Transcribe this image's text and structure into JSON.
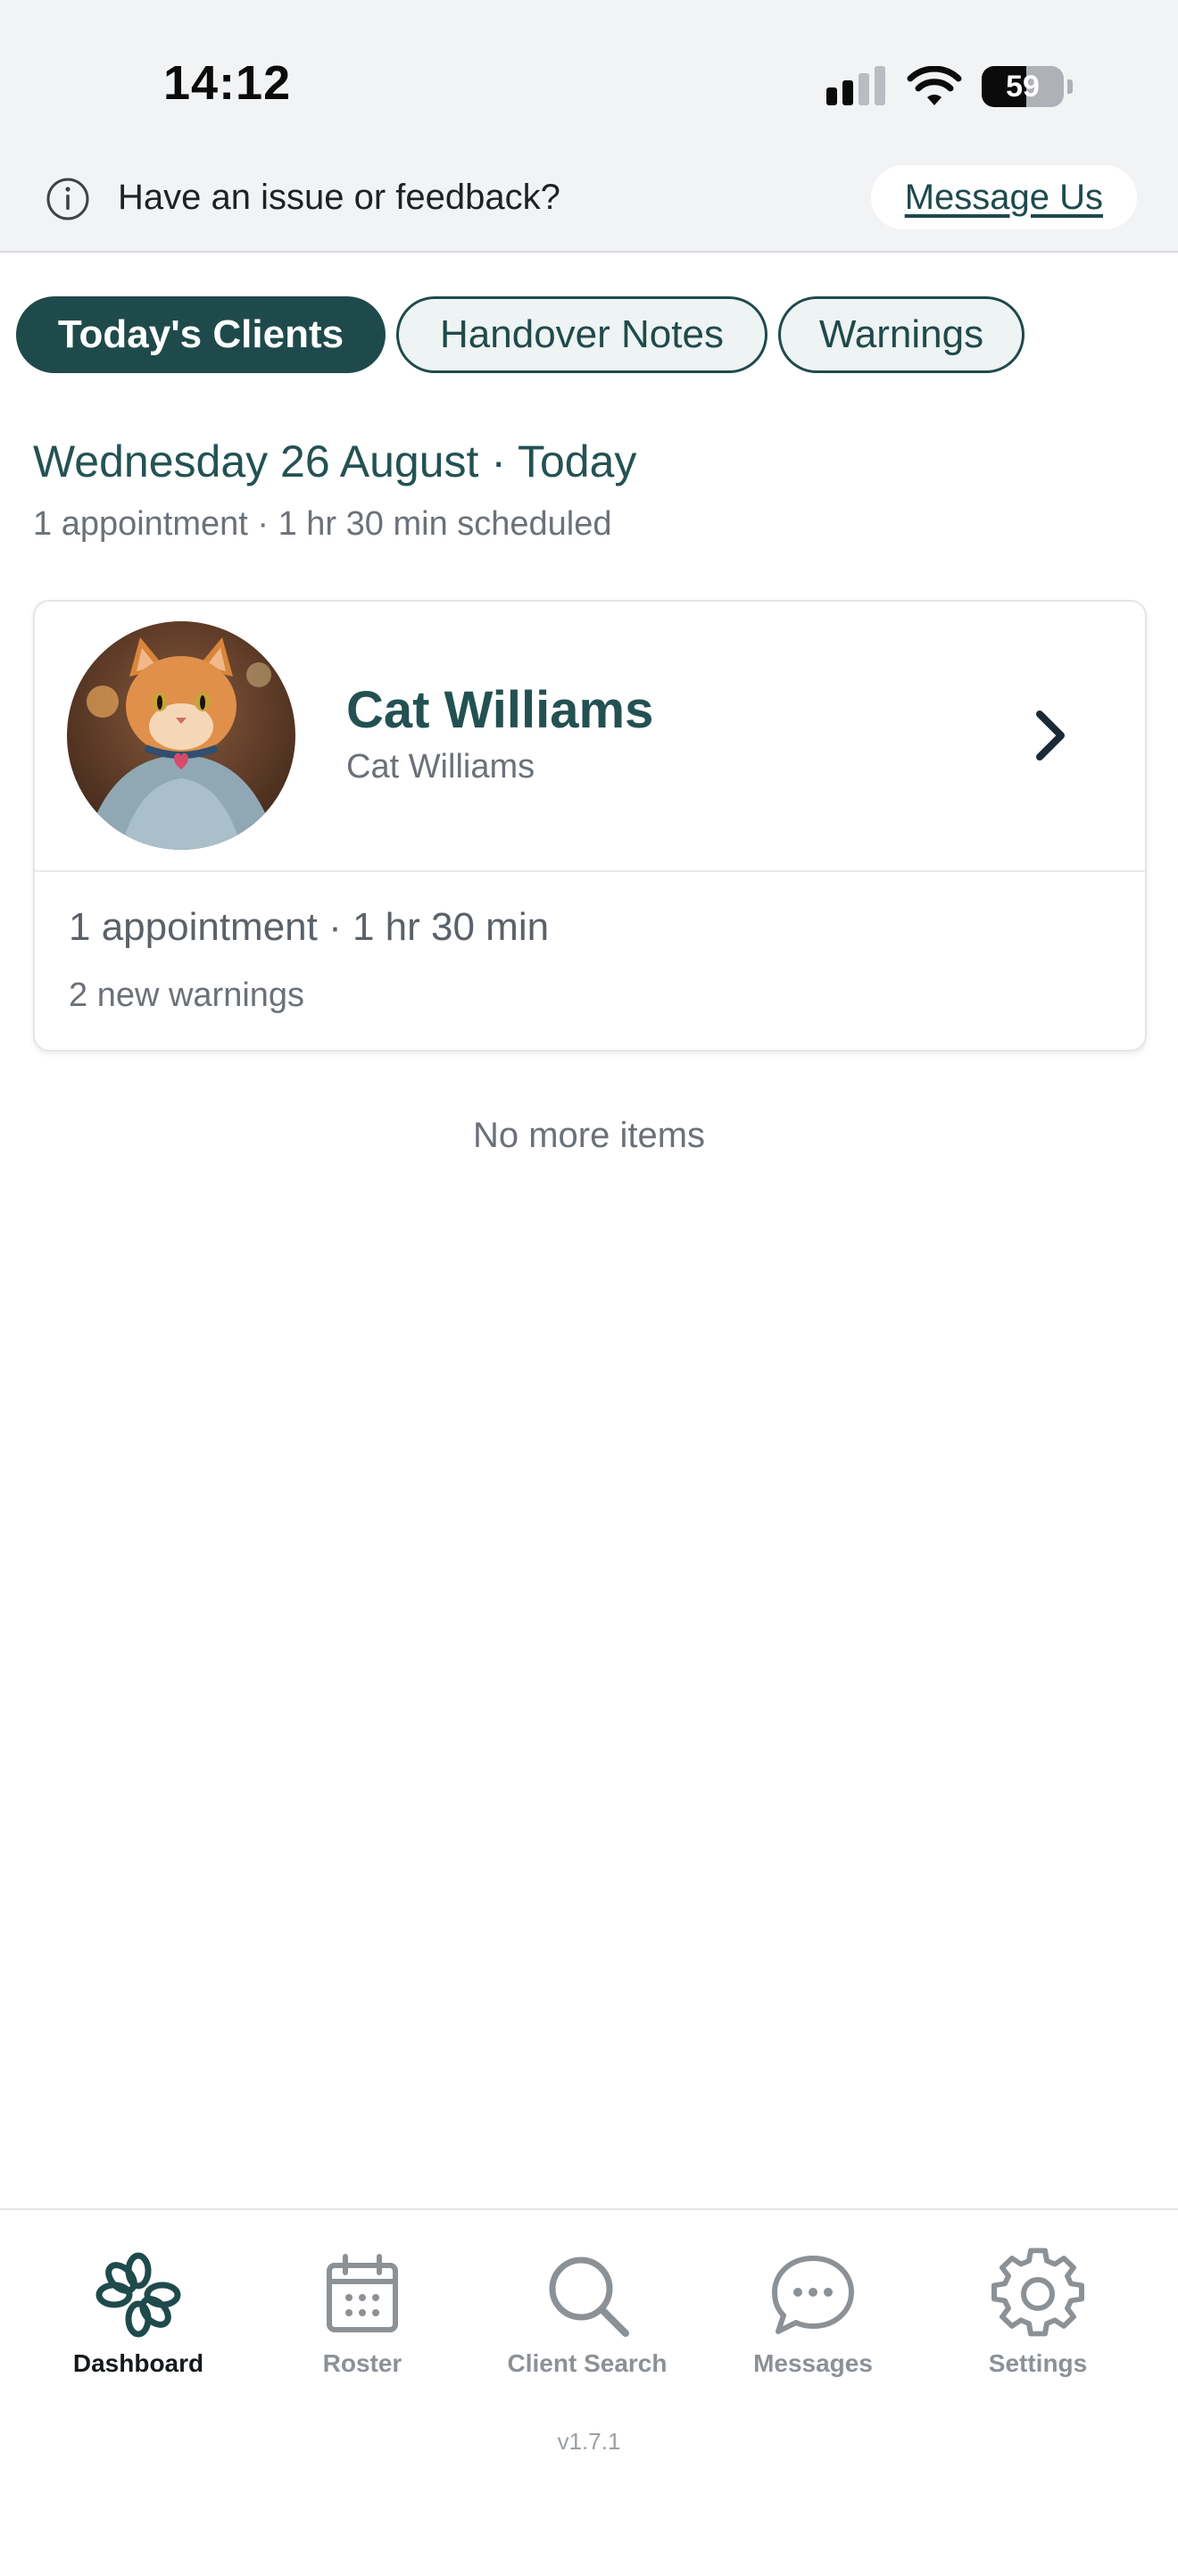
{
  "status_bar": {
    "time": "14:12",
    "battery_level": "59",
    "icons": [
      "cellular-signal-icon",
      "wifi-icon",
      "battery-icon"
    ]
  },
  "feedback": {
    "text": "Have an issue or feedback?",
    "link_label": "Message Us",
    "icon": "info-icon"
  },
  "tabs": [
    {
      "label": "Today's Clients",
      "active": true
    },
    {
      "label": "Handover Notes",
      "active": false
    },
    {
      "label": "Warnings",
      "active": false
    }
  ],
  "day": {
    "heading": "Wednesday 26 August · Today",
    "summary": "1 appointment · 1 hr 30 min scheduled"
  },
  "clients": [
    {
      "name": "Cat Williams",
      "subtitle": "Cat Williams",
      "appointments": "1 appointment · 1 hr 30 min",
      "warnings": "2 new warnings",
      "avatar": "cat-avatar"
    }
  ],
  "list_end": "No more items",
  "nav": {
    "items": [
      {
        "label": "Dashboard",
        "icon": "flower-logo-icon",
        "active": true
      },
      {
        "label": "Roster",
        "icon": "calendar-icon",
        "active": false
      },
      {
        "label": "Client Search",
        "icon": "search-icon",
        "active": false
      },
      {
        "label": "Messages",
        "icon": "chat-bubble-icon",
        "active": false
      },
      {
        "label": "Settings",
        "icon": "gear-icon",
        "active": false
      }
    ],
    "version": "v1.7.1"
  },
  "colors": {
    "brand_dark_teal": "#1f4a4b",
    "heading_teal": "#245252",
    "muted_text": "#6b7177",
    "nav_inactive": "#8c9196",
    "banner_bg": "#f2f3f5"
  }
}
